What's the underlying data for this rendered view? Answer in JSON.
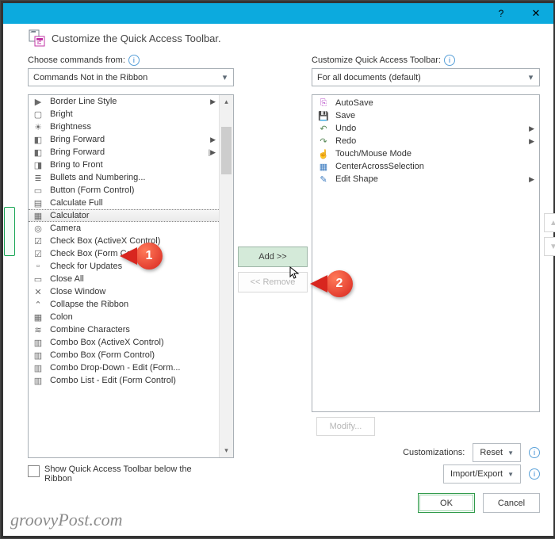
{
  "titlebar": {
    "help": "?",
    "close": "✕"
  },
  "header": {
    "title": "Customize the Quick Access Toolbar."
  },
  "left": {
    "choose_label": "Choose commands from:",
    "dropdown": "Commands Not in the Ribbon",
    "items": [
      "Border Line Style",
      "Bright",
      "Brightness",
      "Bring Forward",
      "Bring Forward",
      "Bring to Front",
      "Bullets and Numbering...",
      "Button (Form Control)",
      "Calculate Full",
      "Calculator",
      "Camera",
      "Check Box (ActiveX Control)",
      "Check Box (Form Control)",
      "Check for Updates",
      "Close All",
      "Close Window",
      "Collapse the Ribbon",
      "Colon",
      "Combine Characters",
      "Combo Box (ActiveX Control)",
      "Combo Box (Form Control)",
      "Combo Drop-Down - Edit (Form...",
      "Combo List - Edit (Form Control)"
    ],
    "selected_index": 9,
    "checkbox_label": "Show Quick Access Toolbar below the Ribbon"
  },
  "mid": {
    "add": "Add >>",
    "remove": "<< Remove"
  },
  "right": {
    "customize_label": "Customize Quick Access Toolbar:",
    "dropdown": "For all documents (default)",
    "items": [
      "AutoSave",
      "Save",
      "Undo",
      "Redo",
      "Touch/Mouse Mode",
      "CenterAcrossSelection",
      "Edit Shape"
    ],
    "modify": "Modify...",
    "custom_label": "Customizations:",
    "reset": "Reset",
    "import_export": "Import/Export"
  },
  "buttons": {
    "ok": "OK",
    "cancel": "Cancel"
  },
  "callouts": {
    "one": "1",
    "two": "2"
  },
  "watermark": "groovyPost.com"
}
